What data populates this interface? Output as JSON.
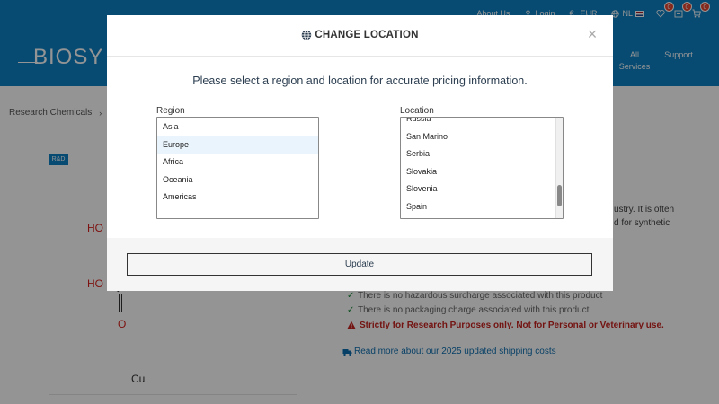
{
  "topbar": {
    "about": "About Us",
    "login": "Login",
    "currency": "EUR",
    "language": "NL",
    "wishlist_count": "0",
    "compare_count": "0",
    "cart_count": "0"
  },
  "logo": {
    "text": "BIOSY"
  },
  "nav": {
    "all_services_line1": "All",
    "all_services_line2": "Services",
    "support": "Support"
  },
  "breadcrumb": {
    "item1": "Research Chemicals",
    "item2": "Co"
  },
  "product": {
    "badge": "R&D",
    "chem_ho1": "HO",
    "chem_ho2": "HO",
    "chem_o": "O",
    "chem_cu": "Cu",
    "desc_line1": "ustry. It is often",
    "desc_line2": "d for synthetic",
    "note1": "There is no hazardous surcharge associated with this product",
    "note2": "There is no packaging charge associated with this product",
    "warning": "Strictly for Research Purposes only. Not for Personal or Veterinary use.",
    "shipping": "Read more about our 2025 updated shipping costs"
  },
  "modal": {
    "title": "CHANGE LOCATION",
    "subtitle": "Please select a region and location for accurate pricing information.",
    "region_label": "Region",
    "location_label": "Location",
    "regions": [
      "Asia",
      "Europe",
      "Africa",
      "Oceania",
      "Americas"
    ],
    "selected_region": "Europe",
    "locations": [
      "Russia",
      "San Marino",
      "Serbia",
      "Slovakia",
      "Slovenia",
      "Spain"
    ],
    "update_label": "Update"
  },
  "colors": {
    "brand_blue": "#0d82c7",
    "badge_red": "#e6442f",
    "warning_red": "#c7231f",
    "check_green": "#1a8d3c"
  }
}
